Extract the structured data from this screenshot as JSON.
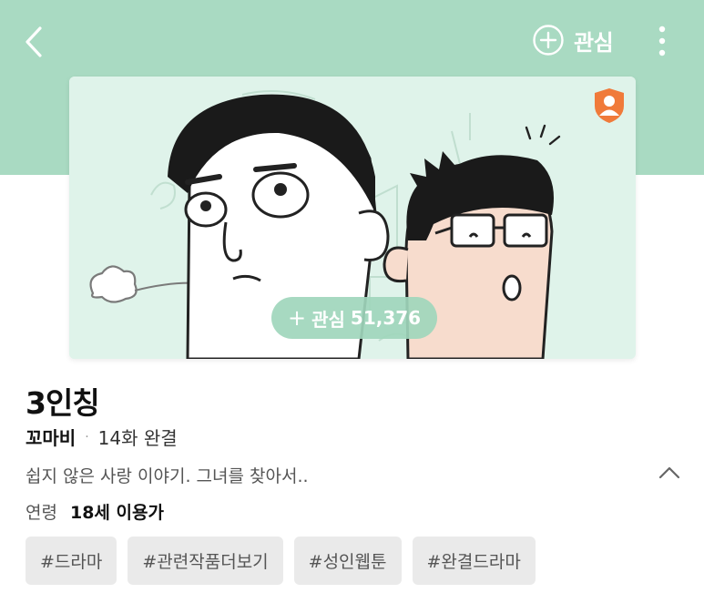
{
  "header": {
    "back_icon": "chevron-left-icon",
    "favorite_icon": "plus-circle-icon",
    "favorite_label": "관심",
    "more_icon": "kebab-vertical-icon",
    "background_color": "#a9dac2"
  },
  "thumbnail": {
    "age_badge_icon": "adult-only-icon",
    "age_badge_color": "#f07a3a",
    "subscribe_plus": "+",
    "subscribe_label": "관심",
    "subscribe_count": "51,376"
  },
  "info": {
    "title": "3인칭",
    "author": "꼬마비",
    "separator": "·",
    "episodes": "14화 완결",
    "description": "쉽지 않은 사랑 이야기. 그녀를 찾아서..",
    "collapse_icon": "chevron-up-icon",
    "age_label": "연령",
    "age_value": "18세 이용가"
  },
  "tags": [
    "#드라마",
    "#관련작품더보기",
    "#성인웹툰",
    "#완결드라마"
  ]
}
